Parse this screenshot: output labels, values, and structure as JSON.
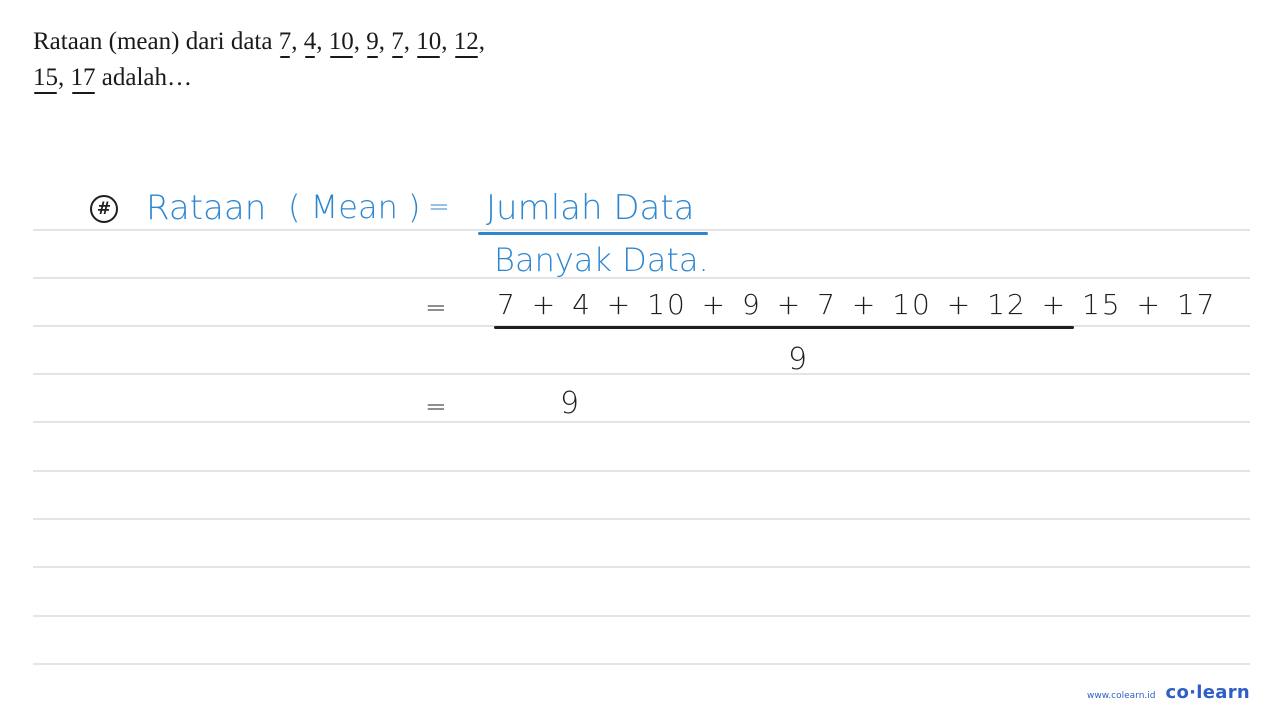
{
  "question": {
    "prefix": "Rataan (mean) dari data ",
    "data_values": [
      "7",
      "4",
      "10",
      "9",
      "7",
      "10",
      "12",
      "15",
      "17"
    ],
    "suffix": " adalah…"
  },
  "solution": {
    "bullet_icon": "hash-circle-icon",
    "bullet_symbol": "#",
    "lhs": "Rataan",
    "lhs_paren": "( Mean )",
    "equals": "=",
    "formula_numerator": "Jumlah Data",
    "formula_denominator": "Banyak Data.",
    "step2_equals": "=",
    "step2_numerator": "7 + 4 + 10 + 9 + 7 + 10 + 12 + 15 + 17",
    "step2_denominator": "9",
    "step3_equals": "=",
    "step3_result": "9"
  },
  "colors": {
    "handwriting_blue": "#2e86d1",
    "handwriting_black": "#1f1f1f",
    "rule_line": "#e3e4e8",
    "brand": "#2f5fc4"
  },
  "footer": {
    "url": "www.colearn.id",
    "logo": "co·learn"
  }
}
